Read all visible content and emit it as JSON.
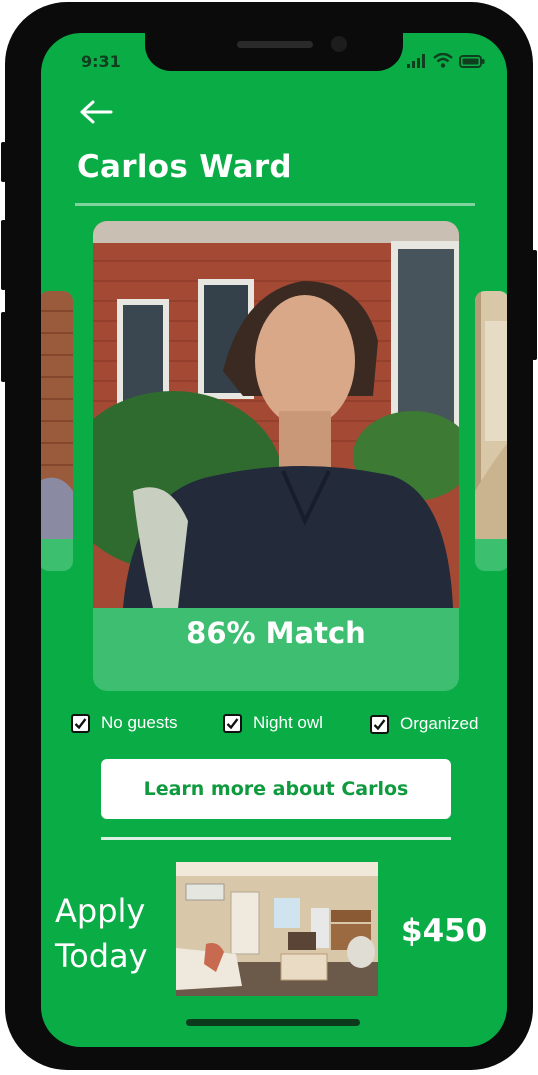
{
  "status_bar": {
    "time": "9:31"
  },
  "header": {
    "title": "Carlos Ward"
  },
  "profile_card": {
    "match_text": "86% Match"
  },
  "preferences": [
    {
      "label": "No guests",
      "checked": true
    },
    {
      "label": "Night owl",
      "checked": true
    },
    {
      "label": "Organized",
      "checked": true
    }
  ],
  "learn_more": {
    "label": "Learn more about Carlos"
  },
  "listing": {
    "apply_line1": "Apply",
    "apply_line2": "Today",
    "price": "$450"
  },
  "colors": {
    "accent": "#0aac46",
    "card": "#3dbe70",
    "button_text": "#0f9a3e"
  }
}
